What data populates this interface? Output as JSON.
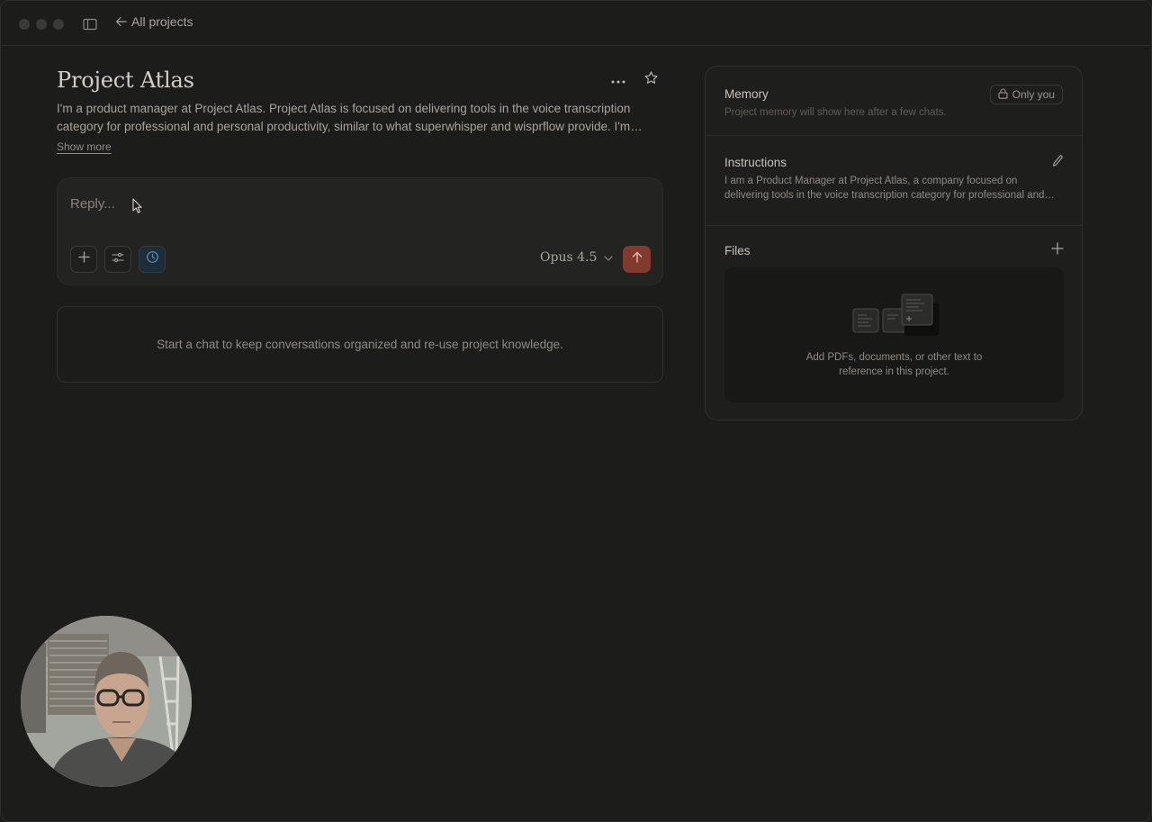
{
  "titlebar": {
    "back_label": "All projects"
  },
  "project": {
    "title": "Project Atlas",
    "description": "I'm a product manager at Project Atlas. Project Atlas is focused on delivering tools in the voice transcription category for professional and personal productivity, similar to what superwhisper and wisprflow provide. I'm exploring new features, user research and competitive positioning for the product.",
    "show_more_label": "Show more"
  },
  "composer": {
    "placeholder": "Reply...",
    "model_label": "Opus 4.5"
  },
  "empty_state": {
    "text": "Start a chat to keep conversations organized and re-use project knowledge."
  },
  "side_panel": {
    "memory": {
      "title": "Memory",
      "visibility_label": "Only you",
      "subtitle": "Project memory will show here after a few chats."
    },
    "instructions": {
      "title": "Instructions",
      "text": "I am a Product Manager at Project Atlas, a company focused on delivering tools in the voice transcription category for professional and personal productivity."
    },
    "files": {
      "title": "Files",
      "dropzone_text_line1": "Add PDFs, documents, or other text to",
      "dropzone_text_line2": "reference in this project."
    }
  },
  "colors": {
    "background": "#1c1c1a",
    "send_button": "#823a2e",
    "research_toggle": "#1f2d3a"
  },
  "icons": [
    "sidebar-toggle-icon",
    "arrow-left-icon",
    "more-horizontal-icon",
    "star-icon",
    "plus-icon",
    "sliders-icon",
    "clock-icon",
    "chevron-down-icon",
    "arrow-up-icon",
    "lock-icon",
    "pencil-icon",
    "documents-icon",
    "mouse-cursor-icon"
  ]
}
